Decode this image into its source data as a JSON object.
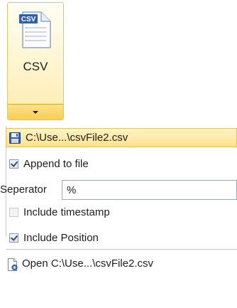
{
  "ribbon": {
    "button_label": "CSV",
    "icon_text": "CSV"
  },
  "menu": {
    "save_path": "C:\\Use...\\csvFile2.csv",
    "append_label": "Append to file",
    "append_checked": true,
    "separator_label": "Seperator",
    "separator_value": "%",
    "timestamp_label": "Include timestamp",
    "timestamp_checked": false,
    "position_label": "Include Position",
    "position_checked": true,
    "open_label": "Open C:\\Use...\\csvFile2.csv"
  },
  "colors": {
    "highlight": "#fde28d",
    "border_gold": "#e3c36c",
    "icon_blue": "#2f5fa8"
  }
}
